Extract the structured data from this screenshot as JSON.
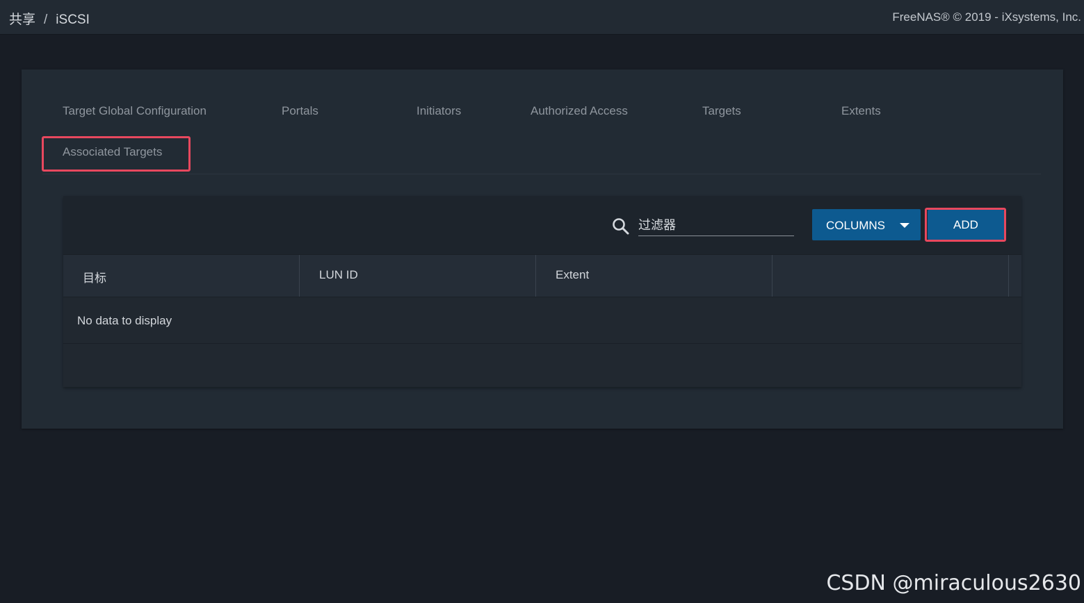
{
  "header": {
    "breadcrumb": [
      "共享",
      "iSCSI"
    ],
    "breadcrumb_separator": "/",
    "copyright": "FreeNAS® © 2019 - iXsystems, Inc."
  },
  "tabs": [
    {
      "label": "Target Global Configuration"
    },
    {
      "label": "Portals"
    },
    {
      "label": "Initiators"
    },
    {
      "label": "Authorized Access"
    },
    {
      "label": "Targets"
    },
    {
      "label": "Extents"
    },
    {
      "label": "Associated Targets",
      "selected": true
    }
  ],
  "toolbar": {
    "filter_placeholder": "过滤器",
    "search_icon": "search-icon",
    "columns_label": "COLUMNS",
    "add_label": "ADD"
  },
  "table": {
    "columns": [
      "目标",
      "LUN ID",
      "Extent",
      ""
    ],
    "empty_message": "No data to display"
  },
  "watermark": "CSDN @miraculous2630",
  "colors": {
    "background": "#181d25",
    "card": "#222b34",
    "button": "#0d5a90",
    "highlight": "#e8485e"
  }
}
